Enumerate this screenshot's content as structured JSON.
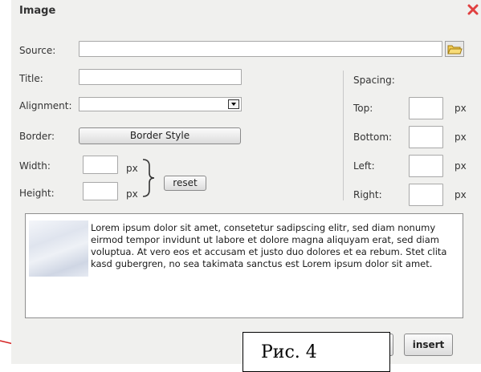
{
  "dialog": {
    "title": "Image"
  },
  "form": {
    "source_label": "Source:",
    "source_value": "",
    "title_label": "Title:",
    "title_value": "",
    "alignment_label": "Alignment:",
    "alignment_value": "",
    "border_label": "Border:",
    "border_button": "Border Style",
    "width_label": "Width:",
    "height_label": "Height:",
    "width_value": "",
    "height_value": "",
    "px_unit": "px",
    "reset_button": "reset"
  },
  "spacing": {
    "heading": "Spacing:",
    "top_label": "Top:",
    "bottom_label": "Bottom:",
    "left_label": "Left:",
    "right_label": "Right:",
    "unit": "px"
  },
  "preview": {
    "text": "Lorem ipsum dolor sit amet, consetetur sadipscing elitr, sed diam nonumy eirmod tempor invidunt ut labore et dolore magna aliquyam erat, sed diam voluptua. At vero eos et accusam et justo duo dolores et ea rebum. Stet clita kasd gubergren, no sea takimata sanctus est Lorem ipsum dolor sit amet."
  },
  "actions": {
    "insert_button": "insert"
  },
  "caption": {
    "text": "Рис. 4"
  },
  "icons": {
    "close": "close-icon",
    "folder": "folder-icon"
  },
  "colors": {
    "dialog_bg": "#f0f0ee",
    "close_red": "#e04040",
    "annotation_line": "#d42020",
    "folder_yellow": "#f2cc55"
  }
}
